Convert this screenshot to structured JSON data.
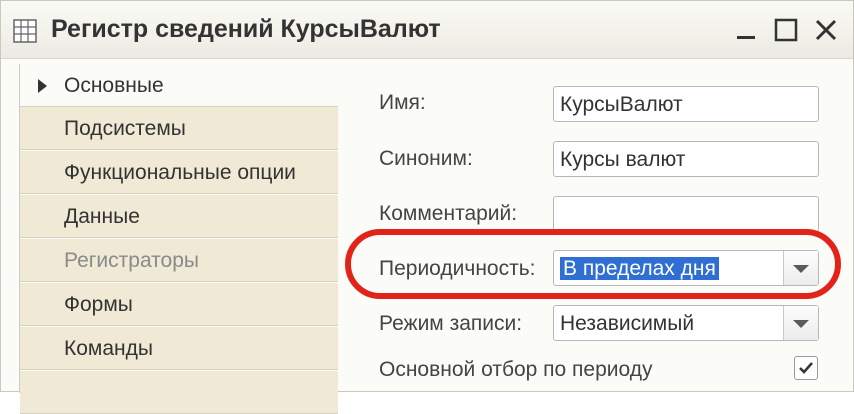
{
  "window": {
    "title": "Регистр сведений КурсыВалют",
    "icon": "table-grid-icon",
    "controls": [
      "minimize-icon",
      "maximize-icon",
      "close-icon"
    ]
  },
  "tabs": [
    {
      "label": "Основные",
      "active": true,
      "disabled": false
    },
    {
      "label": "Подсистемы",
      "active": false,
      "disabled": false
    },
    {
      "label": "Функциональные опции",
      "active": false,
      "disabled": false
    },
    {
      "label": "Данные",
      "active": false,
      "disabled": false
    },
    {
      "label": "Регистраторы",
      "active": false,
      "disabled": true
    },
    {
      "label": "Формы",
      "active": false,
      "disabled": false
    },
    {
      "label": "Команды",
      "active": false,
      "disabled": false
    }
  ],
  "form": {
    "name_label": "Имя:",
    "name_value": "КурсыВалют",
    "synonym_label": "Синоним:",
    "synonym_value": "Курсы валют",
    "comment_label": "Комментарий:",
    "comment_value": "",
    "periodicity_label": "Периодичность:",
    "periodicity_value": "В пределах дня",
    "write_mode_label": "Режим записи:",
    "write_mode_value": "Независимый",
    "period_filter_label": "Основной отбор по периоду",
    "period_filter_checked": true
  },
  "colors": {
    "highlight_outline": "#e2231a",
    "selection": "#2f6fd3",
    "tab_background": "#efe9d5"
  }
}
